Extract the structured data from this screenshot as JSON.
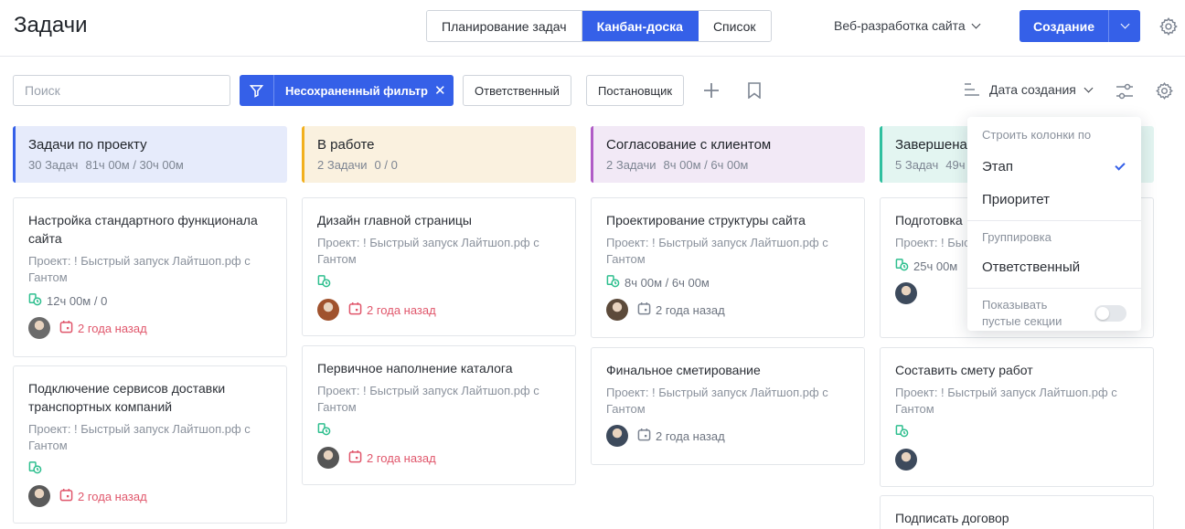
{
  "header": {
    "title": "Задачи",
    "views": [
      "Планирование задач",
      "Канбан-доска",
      "Список"
    ],
    "active_view": 1,
    "project": "Веб-разработка сайта",
    "create_label": "Создание"
  },
  "toolbar": {
    "search_placeholder": "Поиск",
    "filter_label": "Несохраненный фильтр",
    "assignee_label": "Ответственный",
    "reporter_label": "Постановщик",
    "sort_label": "Дата создания"
  },
  "colors": {
    "accent": "#3560e8",
    "overdue": "#e0566b",
    "estimate": "#2fbf8f"
  },
  "columns": [
    {
      "title": "Задачи по проекту",
      "count": "30 Задач",
      "time": "81ч 00м / 30ч 00м",
      "bg": "#e6ebfb",
      "stripe": "#3560e8",
      "cards": [
        {
          "title": "Настройка стандартного функционала сайта",
          "project": "Проект: ! Быстрый запуск Лайтшоп.рф с Гантом",
          "estimate": "12ч 00м / 0",
          "due": "2 года назад",
          "overdue": true,
          "avatar": "#6b6b6b"
        },
        {
          "title": "Подключение сервисов доставки транспортных компаний",
          "project": "Проект: ! Быстрый запуск Лайтшоп.рф с Гантом",
          "estimate": "",
          "due": "2 года назад",
          "overdue": true,
          "avatar": "#5a5a5a"
        }
      ]
    },
    {
      "title": "В работе",
      "count": "2 Задачи",
      "time": "0 / 0",
      "bg": "#faf1df",
      "stripe": "#f2b01e",
      "cards": [
        {
          "title": "Дизайн главной страницы",
          "project": "Проект: ! Быстрый запуск Лайтшоп.рф с Гантом",
          "estimate": "",
          "due": "2 года назад",
          "overdue": true,
          "avatar": "#a0522d"
        },
        {
          "title": "Первичное наполнение каталога",
          "project": "Проект: ! Быстрый запуск Лайтшоп.рф с Гантом",
          "estimate": "",
          "due": "2 года назад",
          "overdue": true,
          "avatar": "#555555"
        }
      ]
    },
    {
      "title": "Согласование с клиентом",
      "count": "2 Задачи",
      "time": "8ч 00м / 6ч 00м",
      "bg": "#f2e9f6",
      "stripe": "#b05cc6",
      "cards": [
        {
          "title": "Проектирование структуры сайта",
          "project": "Проект: ! Быстрый запуск Лайтшоп.рф с Гантом",
          "estimate": "8ч 00м / 6ч 00м",
          "due": "2 года назад",
          "overdue": false,
          "avatar": "#5c4a3a"
        },
        {
          "title": "Финальное сметирование",
          "project": "Проект: ! Быстрый запуск Лайтшоп.рф с Гантом",
          "estimate": "",
          "due": "2 года назад",
          "overdue": false,
          "avatar": "#3d4a5c"
        }
      ]
    },
    {
      "title": "Завершена",
      "count": "5 Задач",
      "time": "49ч",
      "bg": "#e3f5f1",
      "stripe": "#2fbf9f",
      "cards": [
        {
          "title": "Подготовка",
          "project": "Проект: ! Быстрый",
          "estimate": "25ч 00м",
          "due": "",
          "overdue": false,
          "avatar": "#3d4a5c"
        },
        {
          "title": "Составить смету работ",
          "project": "Проект: ! Быстрый запуск Лайтшоп.рф с Гантом",
          "estimate": "",
          "due": "",
          "overdue": false,
          "avatar": "#3d4a5c"
        },
        {
          "title": "Подписать договор",
          "project": "",
          "estimate": "",
          "due": "",
          "overdue": false,
          "avatar": ""
        }
      ]
    }
  ],
  "dropdown": {
    "build_section": "Строить колонки по",
    "options": [
      "Этап",
      "Приоритет"
    ],
    "selected": 0,
    "group_section": "Группировка",
    "group_option": "Ответственный",
    "show_empty": "Показывать пустые секции",
    "show_empty_on": false
  }
}
